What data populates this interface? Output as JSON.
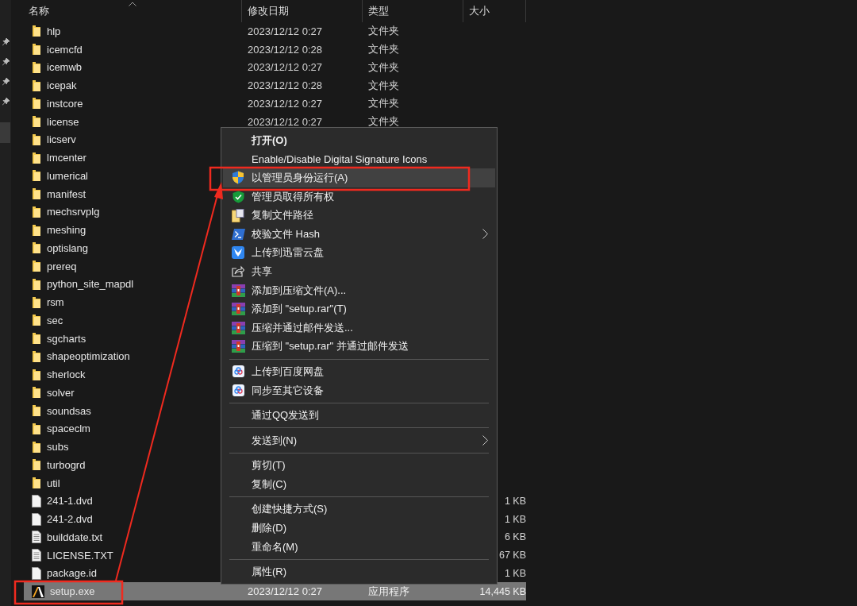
{
  "columns": [
    {
      "label": "名称",
      "sorted": true
    },
    {
      "label": "修改日期",
      "sorted": false
    },
    {
      "label": "类型",
      "sorted": false
    },
    {
      "label": "大小",
      "sorted": false
    }
  ],
  "rows": [
    {
      "name": "hlp",
      "kind": "folder",
      "date": "2023/12/12 0:27",
      "type": "文件夹",
      "selected": false
    },
    {
      "name": "icemcfd",
      "kind": "folder",
      "date": "2023/12/12 0:28",
      "type": "文件夹",
      "selected": false
    },
    {
      "name": "icemwb",
      "kind": "folder",
      "date": "2023/12/12 0:27",
      "type": "文件夹",
      "selected": false
    },
    {
      "name": "icepak",
      "kind": "folder",
      "date": "2023/12/12 0:28",
      "type": "文件夹",
      "selected": false
    },
    {
      "name": "instcore",
      "kind": "folder",
      "date": "2023/12/12 0:27",
      "type": "文件夹",
      "selected": false
    },
    {
      "name": "license",
      "kind": "folder",
      "date": "2023/12/12 0:27",
      "type": "文件夹",
      "selected": false
    },
    {
      "name": "licserv",
      "kind": "folder",
      "selected": false
    },
    {
      "name": "lmcenter",
      "kind": "folder",
      "selected": false
    },
    {
      "name": "lumerical",
      "kind": "folder",
      "selected": false
    },
    {
      "name": "manifest",
      "kind": "folder",
      "selected": false
    },
    {
      "name": "mechsrvplg",
      "kind": "folder",
      "selected": false
    },
    {
      "name": "meshing",
      "kind": "folder",
      "selected": false
    },
    {
      "name": "optislang",
      "kind": "folder",
      "selected": false
    },
    {
      "name": "prereq",
      "kind": "folder",
      "selected": false
    },
    {
      "name": "python_site_mapdl",
      "kind": "folder",
      "selected": false
    },
    {
      "name": "rsm",
      "kind": "folder",
      "selected": false
    },
    {
      "name": "sec",
      "kind": "folder",
      "selected": false
    },
    {
      "name": "sgcharts",
      "kind": "folder",
      "selected": false
    },
    {
      "name": "shapeoptimization",
      "kind": "folder",
      "selected": false
    },
    {
      "name": "sherlock",
      "kind": "folder",
      "selected": false
    },
    {
      "name": "solver",
      "kind": "folder",
      "selected": false
    },
    {
      "name": "soundsas",
      "kind": "folder",
      "selected": false
    },
    {
      "name": "spaceclm",
      "kind": "folder",
      "selected": false
    },
    {
      "name": "subs",
      "kind": "folder",
      "selected": false
    },
    {
      "name": "turbogrd",
      "kind": "folder",
      "selected": false
    },
    {
      "name": "util",
      "kind": "folder",
      "selected": false
    },
    {
      "name": "241-1.dvd",
      "kind": "file",
      "size": "1 KB",
      "selected": false
    },
    {
      "name": "241-2.dvd",
      "kind": "file",
      "size": "1 KB",
      "selected": false
    },
    {
      "name": "builddate.txt",
      "kind": "text",
      "size": "6 KB",
      "selected": false
    },
    {
      "name": "LICENSE.TXT",
      "kind": "text",
      "size": "67 KB",
      "selected": false
    },
    {
      "name": "package.id",
      "kind": "file",
      "size": "1 KB",
      "selected": false
    },
    {
      "name": "setup.exe",
      "kind": "exe",
      "date": "2023/12/12 0:27",
      "type": "应用程序",
      "size": "14,445 KB",
      "selected": true
    }
  ],
  "context_menu": [
    {
      "kind": "item",
      "label": "打开(O)",
      "default": true,
      "submenu": false,
      "highlighted": false
    },
    {
      "kind": "item",
      "label": "Enable/Disable Digital Signature Icons",
      "default": false,
      "submenu": false,
      "highlighted": false
    },
    {
      "kind": "item",
      "label": "以管理员身份运行(A)",
      "default": false,
      "submenu": false,
      "highlighted": true
    },
    {
      "kind": "item",
      "label": "管理员取得所有权",
      "default": false,
      "submenu": false,
      "highlighted": false
    },
    {
      "kind": "item",
      "label": "复制文件路径",
      "default": false,
      "submenu": false,
      "highlighted": false
    },
    {
      "kind": "item",
      "label": "校验文件 Hash",
      "default": false,
      "submenu": true,
      "highlighted": false
    },
    {
      "kind": "item",
      "label": "上传到迅雷云盘",
      "default": false,
      "submenu": false,
      "highlighted": false
    },
    {
      "kind": "item",
      "label": "共享",
      "default": false,
      "submenu": false,
      "highlighted": false
    },
    {
      "kind": "item",
      "label": "添加到压缩文件(A)...",
      "default": false,
      "submenu": false,
      "highlighted": false
    },
    {
      "kind": "item",
      "label": "添加到 \"setup.rar\"(T)",
      "default": false,
      "submenu": false,
      "highlighted": false
    },
    {
      "kind": "item",
      "label": "压缩并通过邮件发送...",
      "default": false,
      "submenu": false,
      "highlighted": false
    },
    {
      "kind": "item",
      "label": "压缩到 \"setup.rar\" 并通过邮件发送",
      "default": false,
      "submenu": false,
      "highlighted": false
    },
    {
      "kind": "separator"
    },
    {
      "kind": "item",
      "label": "上传到百度网盘",
      "default": false,
      "submenu": false,
      "highlighted": false
    },
    {
      "kind": "item",
      "label": "同步至其它设备",
      "default": false,
      "submenu": false,
      "highlighted": false
    },
    {
      "kind": "separator"
    },
    {
      "kind": "item",
      "label": "通过QQ发送到",
      "default": false,
      "submenu": false,
      "highlighted": false
    },
    {
      "kind": "separator"
    },
    {
      "kind": "item",
      "label": "发送到(N)",
      "default": false,
      "submenu": true,
      "highlighted": false
    },
    {
      "kind": "separator"
    },
    {
      "kind": "item",
      "label": "剪切(T)",
      "default": false,
      "submenu": false,
      "highlighted": false
    },
    {
      "kind": "item",
      "label": "复制(C)",
      "default": false,
      "submenu": false,
      "highlighted": false
    },
    {
      "kind": "separator"
    },
    {
      "kind": "item",
      "label": "创建快捷方式(S)",
      "default": false,
      "submenu": false,
      "highlighted": false
    },
    {
      "kind": "item",
      "label": "删除(D)",
      "default": false,
      "submenu": false,
      "highlighted": false
    },
    {
      "kind": "item",
      "label": "重命名(M)",
      "default": false,
      "submenu": false,
      "highlighted": false
    },
    {
      "kind": "separator"
    },
    {
      "kind": "item",
      "label": "属性(R)",
      "default": false,
      "submenu": false,
      "highlighted": false
    }
  ]
}
